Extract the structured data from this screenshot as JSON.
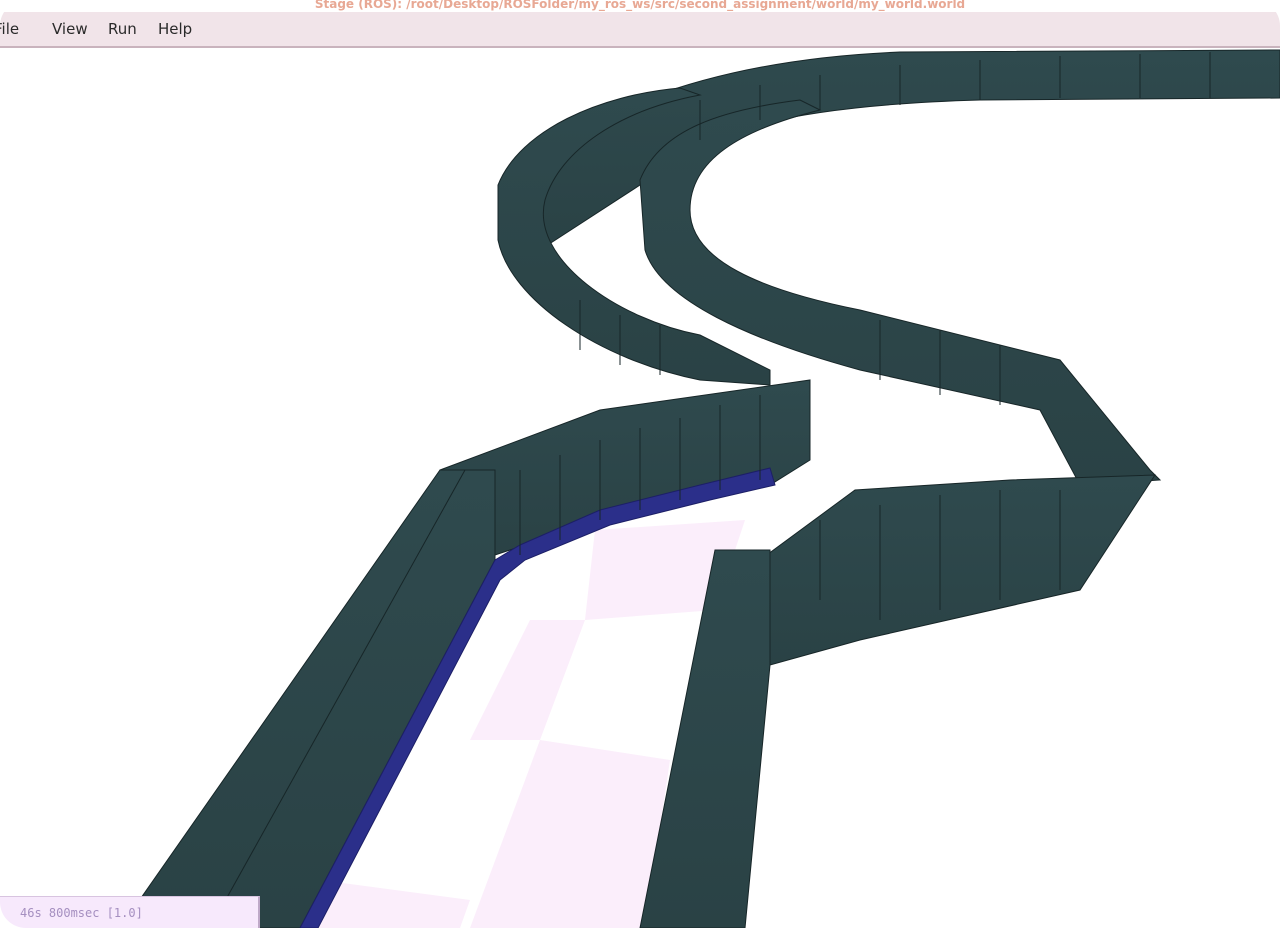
{
  "window": {
    "title": "Stage (ROS): /root/Desktop/ROSFolder/my_ros_ws/src/second_assignment/world/my_world.world"
  },
  "menubar": {
    "items": [
      {
        "label": "File",
        "mnemonic": "F"
      },
      {
        "label": "View",
        "mnemonic": "V"
      },
      {
        "label": "Run",
        "mnemonic": "R"
      },
      {
        "label": "Help",
        "mnemonic": "H"
      }
    ]
  },
  "status": {
    "text": "46s 800msec [1.0]"
  },
  "colors": {
    "wall": "#2b4549",
    "wall_edge": "#172628",
    "robot_trail": "#2b2f8a",
    "floor_tile": "#fbeefb",
    "menubar_bg": "#f1e4e9",
    "status_bg": "#f7e9fc"
  }
}
